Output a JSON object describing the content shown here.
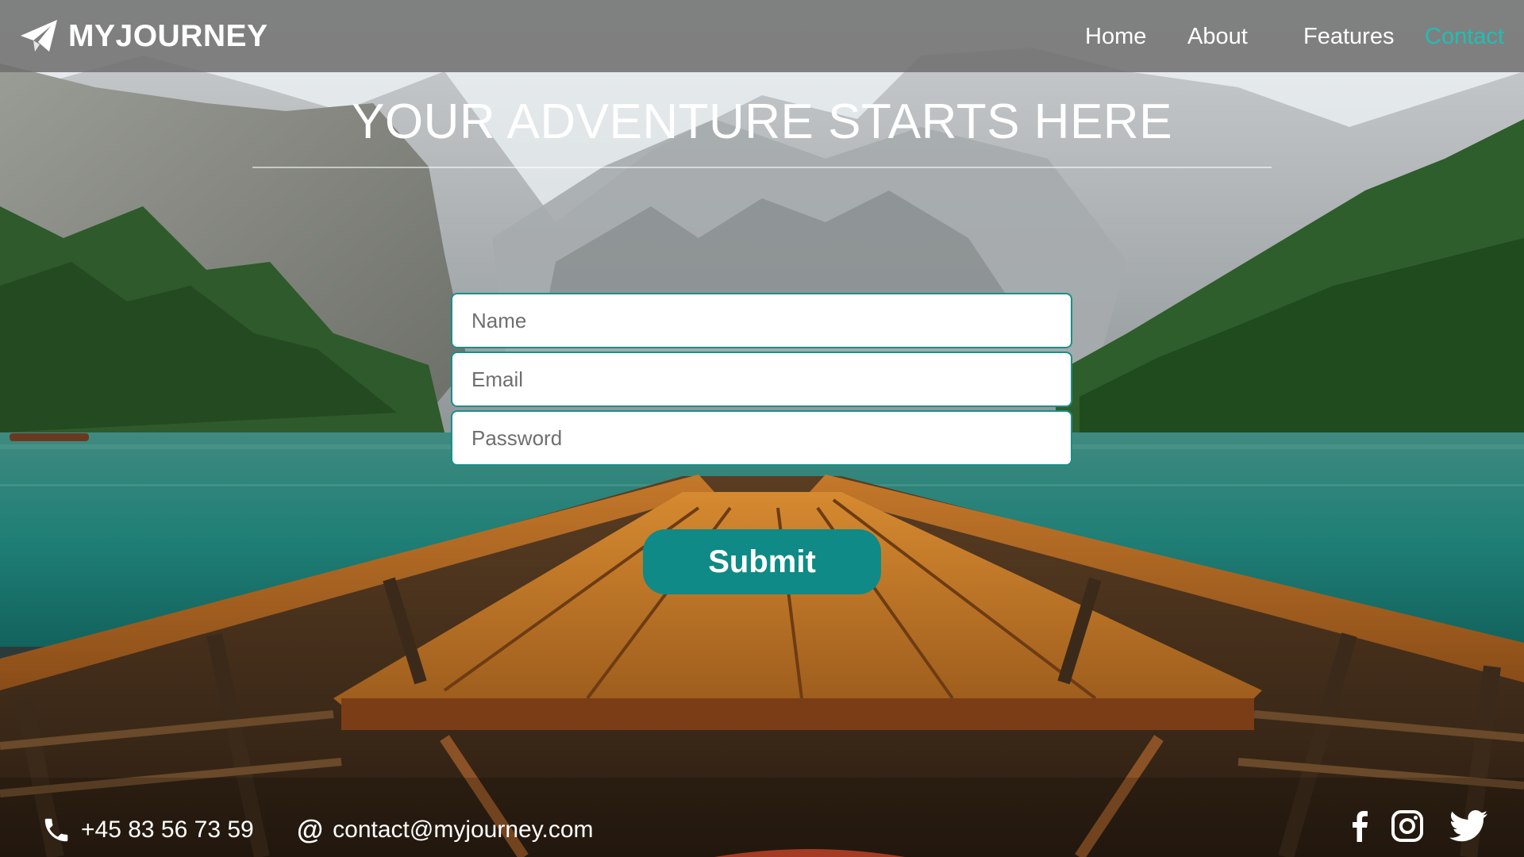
{
  "brand": {
    "name": "MYJOURNEY",
    "logo_icon": "paper-plane-icon"
  },
  "nav": {
    "links": [
      {
        "label": "Home",
        "active": false
      },
      {
        "label": "About",
        "active": false
      },
      {
        "label": "Features",
        "active": false
      },
      {
        "label": "Contact",
        "active": true
      }
    ]
  },
  "hero": {
    "title": "YOUR ADVENTURE STARTS HERE"
  },
  "form": {
    "name_placeholder": "Name",
    "email_placeholder": "Email",
    "password_placeholder": "Password",
    "submit_label": "Submit"
  },
  "footer": {
    "phone": "+45 83 56 73 59",
    "email": "contact@myjourney.com",
    "social": [
      "facebook-icon",
      "instagram-icon",
      "twitter-icon"
    ]
  },
  "colors": {
    "navbar_bg": "#6e6e6e",
    "accent": "#1fbfb2",
    "button": "#0f8a86",
    "field_border": "#1a8f8a"
  }
}
